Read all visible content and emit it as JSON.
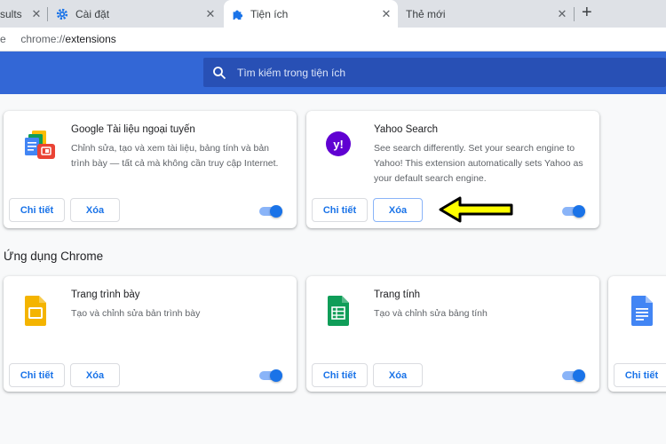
{
  "tabs": [
    {
      "label": "sults",
      "active": false
    },
    {
      "label": "Cài đặt",
      "active": false,
      "icon": "gear-icon"
    },
    {
      "label": "Tiện ích",
      "active": true,
      "icon": "puzzle-icon"
    },
    {
      "label": "Thẻ mới",
      "active": false
    }
  ],
  "tab_close_glyph": "✕",
  "new_tab_glyph": "+",
  "address": {
    "scheme": "chrome://",
    "path": "extensions",
    "left_fragment": "e"
  },
  "search": {
    "placeholder": "Tìm kiếm trong tiện ích"
  },
  "extensions": [
    {
      "name": "Google Tài liệu ngoại tuyến",
      "description": "Chỉnh sửa, tạo và xem tài liệu, bảng tính và bản trình bày — tất cả mà không cần truy cập Internet.",
      "enabled": true,
      "icon": "google-docs-offline-icon"
    },
    {
      "name": "Yahoo Search",
      "description": "See search differently. Set your search engine to Yahoo! This extension automatically sets Yahoo as your default search engine.",
      "enabled": true,
      "icon": "yahoo-icon",
      "icon_text": "y!"
    }
  ],
  "section_title": "Ứng dụng Chrome",
  "apps": [
    {
      "name": "Trang trình bày",
      "description": "Tạo và chỉnh sửa bản trình bày",
      "enabled": true,
      "icon": "google-slides-icon"
    },
    {
      "name": "Trang tính",
      "description": "Tạo và chỉnh sửa bảng tính",
      "enabled": true,
      "icon": "google-sheets-icon"
    },
    {
      "name": "",
      "description": "",
      "enabled": true,
      "icon": "google-docs-icon"
    }
  ],
  "buttons": {
    "details": "Chi tiết",
    "remove": "Xóa"
  },
  "colors": {
    "header": "#3367d6",
    "accent": "#1a73e8",
    "arrow": "#ffff00"
  }
}
